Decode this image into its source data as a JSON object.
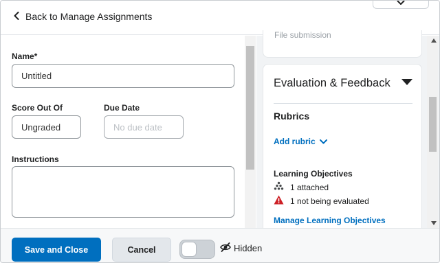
{
  "header": {
    "back_label": "Back to Manage Assignments"
  },
  "form": {
    "name_label": "Name*",
    "name_value": "Untitled",
    "score_label": "Score Out Of",
    "score_value": "Ungraded",
    "due_label": "Due Date",
    "due_placeholder": "No due date",
    "instructions_label": "Instructions"
  },
  "right_panel": {
    "top_card_text": "File submission",
    "section_title": "Evaluation & Feedback",
    "rubrics_label": "Rubrics",
    "add_rubric_label": "Add rubric",
    "lo_label": "Learning Objectives",
    "lo_attached": "1 attached",
    "lo_not_evaluated": "1 not being evaluated",
    "manage_lo_label": "Manage Learning Objectives"
  },
  "footer": {
    "save_label": "Save and Close",
    "cancel_label": "Cancel",
    "visibility_label": "Hidden"
  },
  "colors": {
    "primary": "#006fbf",
    "warning": "#cd2026",
    "panel_bg": "#f1f3f5"
  }
}
